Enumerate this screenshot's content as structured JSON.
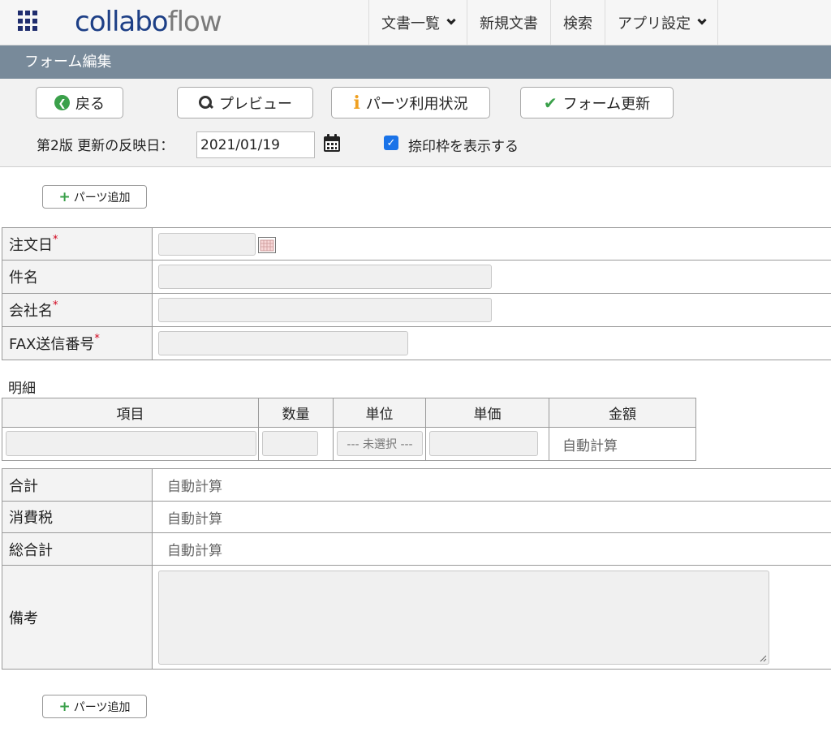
{
  "header": {
    "logo_main": "collabo",
    "logo_accent": "flow",
    "nav": [
      {
        "label": "文書一覧",
        "dropdown": true
      },
      {
        "label": "新規文書",
        "dropdown": false
      },
      {
        "label": "検索",
        "dropdown": false
      },
      {
        "label": "アプリ設定",
        "dropdown": true
      }
    ]
  },
  "section_title": "フォーム編集",
  "toolbar": {
    "back_label": "戻る",
    "preview_label": "プレビュー",
    "parts_usage_label": "パーツ利用状況",
    "update_label": "フォーム更新",
    "version_label": "第2版 更新の反映日：",
    "reflect_date": "2021/01/19",
    "stamp_label": "捺印枠を表示する",
    "stamp_checked": true
  },
  "add_part_label": "パーツ追加",
  "fields": [
    {
      "label": "注文日",
      "required": true
    },
    {
      "label": "件名",
      "required": false
    },
    {
      "label": "会社名",
      "required": true
    },
    {
      "label": "FAX送信番号",
      "required": true
    }
  ],
  "detail": {
    "title": "明細",
    "columns": [
      "項目",
      "数量",
      "単位",
      "単価",
      "金額"
    ],
    "unit_select": "--- 未選択 ---",
    "amount": "自動計算"
  },
  "totals": [
    {
      "label": "合計",
      "value": "自動計算"
    },
    {
      "label": "消費税",
      "value": "自動計算"
    },
    {
      "label": "総合計",
      "value": "自動計算"
    }
  ],
  "remarks_label": "備考",
  "colors": {
    "section_bar": "#788a9a",
    "brand": "#1d3f86",
    "accent_green": "#3aa04a",
    "required_red": "#d0021b",
    "checkbox_blue": "#1a73e8"
  }
}
